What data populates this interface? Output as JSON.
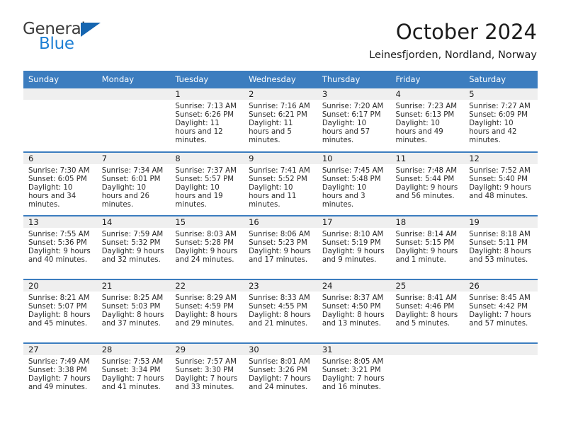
{
  "brand": {
    "name_top": "General",
    "name_bottom": "Blue",
    "triangle_color": "#1565b0",
    "blue_color": "#1d7fd4"
  },
  "header": {
    "title": "October 2024",
    "subtitle": "Leinesfjorden, Nordland, Norway"
  },
  "theme": {
    "header_blue": "#3c7dbf",
    "daynum_band": "#efefef",
    "text": "#1b1b1b"
  },
  "weekday_headers": [
    "Sunday",
    "Monday",
    "Tuesday",
    "Wednesday",
    "Thursday",
    "Friday",
    "Saturday"
  ],
  "weeks": [
    [
      {
        "day": "",
        "sunrise": "",
        "sunset": "",
        "daylight": "",
        "empty": true
      },
      {
        "day": "",
        "sunrise": "",
        "sunset": "",
        "daylight": "",
        "empty": true
      },
      {
        "day": "1",
        "sunrise": "Sunrise: 7:13 AM",
        "sunset": "Sunset: 6:26 PM",
        "daylight": "Daylight: 11 hours and 12 minutes."
      },
      {
        "day": "2",
        "sunrise": "Sunrise: 7:16 AM",
        "sunset": "Sunset: 6:21 PM",
        "daylight": "Daylight: 11 hours and 5 minutes."
      },
      {
        "day": "3",
        "sunrise": "Sunrise: 7:20 AM",
        "sunset": "Sunset: 6:17 PM",
        "daylight": "Daylight: 10 hours and 57 minutes."
      },
      {
        "day": "4",
        "sunrise": "Sunrise: 7:23 AM",
        "sunset": "Sunset: 6:13 PM",
        "daylight": "Daylight: 10 hours and 49 minutes."
      },
      {
        "day": "5",
        "sunrise": "Sunrise: 7:27 AM",
        "sunset": "Sunset: 6:09 PM",
        "daylight": "Daylight: 10 hours and 42 minutes."
      }
    ],
    [
      {
        "day": "6",
        "sunrise": "Sunrise: 7:30 AM",
        "sunset": "Sunset: 6:05 PM",
        "daylight": "Daylight: 10 hours and 34 minutes."
      },
      {
        "day": "7",
        "sunrise": "Sunrise: 7:34 AM",
        "sunset": "Sunset: 6:01 PM",
        "daylight": "Daylight: 10 hours and 26 minutes."
      },
      {
        "day": "8",
        "sunrise": "Sunrise: 7:37 AM",
        "sunset": "Sunset: 5:57 PM",
        "daylight": "Daylight: 10 hours and 19 minutes."
      },
      {
        "day": "9",
        "sunrise": "Sunrise: 7:41 AM",
        "sunset": "Sunset: 5:52 PM",
        "daylight": "Daylight: 10 hours and 11 minutes."
      },
      {
        "day": "10",
        "sunrise": "Sunrise: 7:45 AM",
        "sunset": "Sunset: 5:48 PM",
        "daylight": "Daylight: 10 hours and 3 minutes."
      },
      {
        "day": "11",
        "sunrise": "Sunrise: 7:48 AM",
        "sunset": "Sunset: 5:44 PM",
        "daylight": "Daylight: 9 hours and 56 minutes."
      },
      {
        "day": "12",
        "sunrise": "Sunrise: 7:52 AM",
        "sunset": "Sunset: 5:40 PM",
        "daylight": "Daylight: 9 hours and 48 minutes."
      }
    ],
    [
      {
        "day": "13",
        "sunrise": "Sunrise: 7:55 AM",
        "sunset": "Sunset: 5:36 PM",
        "daylight": "Daylight: 9 hours and 40 minutes."
      },
      {
        "day": "14",
        "sunrise": "Sunrise: 7:59 AM",
        "sunset": "Sunset: 5:32 PM",
        "daylight": "Daylight: 9 hours and 32 minutes."
      },
      {
        "day": "15",
        "sunrise": "Sunrise: 8:03 AM",
        "sunset": "Sunset: 5:28 PM",
        "daylight": "Daylight: 9 hours and 24 minutes."
      },
      {
        "day": "16",
        "sunrise": "Sunrise: 8:06 AM",
        "sunset": "Sunset: 5:23 PM",
        "daylight": "Daylight: 9 hours and 17 minutes."
      },
      {
        "day": "17",
        "sunrise": "Sunrise: 8:10 AM",
        "sunset": "Sunset: 5:19 PM",
        "daylight": "Daylight: 9 hours and 9 minutes."
      },
      {
        "day": "18",
        "sunrise": "Sunrise: 8:14 AM",
        "sunset": "Sunset: 5:15 PM",
        "daylight": "Daylight: 9 hours and 1 minute."
      },
      {
        "day": "19",
        "sunrise": "Sunrise: 8:18 AM",
        "sunset": "Sunset: 5:11 PM",
        "daylight": "Daylight: 8 hours and 53 minutes."
      }
    ],
    [
      {
        "day": "20",
        "sunrise": "Sunrise: 8:21 AM",
        "sunset": "Sunset: 5:07 PM",
        "daylight": "Daylight: 8 hours and 45 minutes."
      },
      {
        "day": "21",
        "sunrise": "Sunrise: 8:25 AM",
        "sunset": "Sunset: 5:03 PM",
        "daylight": "Daylight: 8 hours and 37 minutes."
      },
      {
        "day": "22",
        "sunrise": "Sunrise: 8:29 AM",
        "sunset": "Sunset: 4:59 PM",
        "daylight": "Daylight: 8 hours and 29 minutes."
      },
      {
        "day": "23",
        "sunrise": "Sunrise: 8:33 AM",
        "sunset": "Sunset: 4:55 PM",
        "daylight": "Daylight: 8 hours and 21 minutes."
      },
      {
        "day": "24",
        "sunrise": "Sunrise: 8:37 AM",
        "sunset": "Sunset: 4:50 PM",
        "daylight": "Daylight: 8 hours and 13 minutes."
      },
      {
        "day": "25",
        "sunrise": "Sunrise: 8:41 AM",
        "sunset": "Sunset: 4:46 PM",
        "daylight": "Daylight: 8 hours and 5 minutes."
      },
      {
        "day": "26",
        "sunrise": "Sunrise: 8:45 AM",
        "sunset": "Sunset: 4:42 PM",
        "daylight": "Daylight: 7 hours and 57 minutes."
      }
    ],
    [
      {
        "day": "27",
        "sunrise": "Sunrise: 7:49 AM",
        "sunset": "Sunset: 3:38 PM",
        "daylight": "Daylight: 7 hours and 49 minutes."
      },
      {
        "day": "28",
        "sunrise": "Sunrise: 7:53 AM",
        "sunset": "Sunset: 3:34 PM",
        "daylight": "Daylight: 7 hours and 41 minutes."
      },
      {
        "day": "29",
        "sunrise": "Sunrise: 7:57 AM",
        "sunset": "Sunset: 3:30 PM",
        "daylight": "Daylight: 7 hours and 33 minutes."
      },
      {
        "day": "30",
        "sunrise": "Sunrise: 8:01 AM",
        "sunset": "Sunset: 3:26 PM",
        "daylight": "Daylight: 7 hours and 24 minutes."
      },
      {
        "day": "31",
        "sunrise": "Sunrise: 8:05 AM",
        "sunset": "Sunset: 3:21 PM",
        "daylight": "Daylight: 7 hours and 16 minutes."
      },
      {
        "day": "",
        "sunrise": "",
        "sunset": "",
        "daylight": "",
        "empty": true
      },
      {
        "day": "",
        "sunrise": "",
        "sunset": "",
        "daylight": "",
        "empty": true
      }
    ]
  ]
}
